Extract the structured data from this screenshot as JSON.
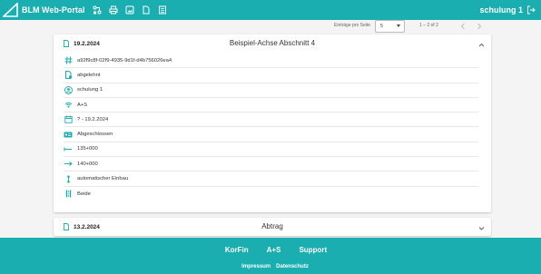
{
  "header": {
    "app_title": "BLM Web-Portal",
    "user_name": "schulung 1",
    "nav_icons": [
      "route-icon",
      "printer-icon",
      "image-icon",
      "document-icon",
      "table-icon"
    ],
    "accent_color": "#1aaeb0"
  },
  "pagination": {
    "entries_label": "Einträge pro Seite",
    "entries_value": "5",
    "range": "1 – 2 of 2"
  },
  "cards": [
    {
      "date": "19.2.2024",
      "title": "Beispiel-Achse Abschnitt 4",
      "expanded": true,
      "rows": [
        {
          "icon": "hash-icon",
          "value": "a92f9c8f-02f9-4935-9d1f-d4b756026ea4"
        },
        {
          "icon": "file-status-icon",
          "value": "abgelehnt"
        },
        {
          "icon": "user-icon",
          "value": "schulung 1"
        },
        {
          "icon": "wifi-antenna-icon",
          "value": "A+S"
        },
        {
          "icon": "calendar-icon",
          "value": "? - 19.2.2024"
        },
        {
          "icon": "id-card-icon",
          "value": "Abgeschlossen"
        },
        {
          "icon": "arrow-left-start-icon",
          "value": "135+000"
        },
        {
          "icon": "arrow-right-end-icon",
          "value": "140+000"
        },
        {
          "icon": "vertical-arrows-icon",
          "value": "automatischer Einbau"
        },
        {
          "icon": "lanes-icon",
          "value": "Beide"
        }
      ]
    },
    {
      "date": "13.2.2024",
      "title": "Abtrag",
      "expanded": false
    }
  ],
  "footer": {
    "links": [
      "KorFin",
      "A+S",
      "Support"
    ],
    "sub_links": [
      "Impressum",
      "Datenschutz"
    ]
  }
}
